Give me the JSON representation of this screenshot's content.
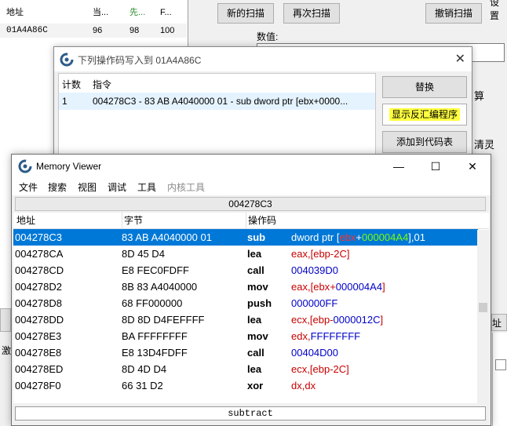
{
  "main_window": {
    "list_headers": {
      "address": "地址",
      "current": "当...",
      "previous": "先...",
      "first": "F..."
    },
    "list_row": {
      "address": "01A4A86C",
      "current": "96",
      "previous": "98",
      "first": "100"
    },
    "buttons": {
      "new_scan": "新的扫描",
      "next_scan": "再次扫描",
      "undo_scan": "撤销扫描"
    },
    "value_label": "数值:",
    "corner_text": "设置",
    "right_fragments": [
      "算",
      "清灵"
    ],
    "lower_fragments": {
      "left": "激",
      "right": "址"
    }
  },
  "dialog": {
    "title": "下列操作码写入到 01A4A86C",
    "headers": {
      "count": "计数",
      "instruction": "指令"
    },
    "row": {
      "count": "1",
      "instruction": "004278C3 - 83 AB A4040000 01 - sub dword ptr [ebx+0000..."
    },
    "buttons": {
      "replace": "替换",
      "show_disasm": "显示反汇编程序",
      "add_to_codelist": "添加到代码表"
    }
  },
  "memory_viewer": {
    "title": "Memory Viewer",
    "menu": [
      "文件",
      "搜索",
      "视图",
      "调试",
      "工具",
      "内核工具"
    ],
    "address_bar": "004278C3",
    "headers": {
      "address": "地址",
      "bytes": "字节",
      "opcode": "操作码"
    },
    "rows": [
      {
        "address": "004278C3",
        "bytes": "83 AB A4040000 01",
        "opcode": "sub",
        "operand": "dword ptr [ebx+000004A4],01"
      },
      {
        "address": "004278CA",
        "bytes": "8D 45 D4",
        "opcode": "lea",
        "operand": "eax,[ebp-2C]"
      },
      {
        "address": "004278CD",
        "bytes": "E8 FEC0FDFF",
        "opcode": "call",
        "operand": "004039D0"
      },
      {
        "address": "004278D2",
        "bytes": "8B 83 A4040000",
        "opcode": "mov",
        "operand": "eax,[ebx+000004A4]"
      },
      {
        "address": "004278D8",
        "bytes": "68 FF000000",
        "opcode": "push",
        "operand": "000000FF"
      },
      {
        "address": "004278DD",
        "bytes": "8D 8D D4FEFFFF",
        "opcode": "lea",
        "operand": "ecx,[ebp-0000012C]"
      },
      {
        "address": "004278E3",
        "bytes": "BA FFFFFFFF",
        "opcode": "mov",
        "operand": "edx,FFFFFFFF"
      },
      {
        "address": "004278E8",
        "bytes": "E8 13D4FDFF",
        "opcode": "call",
        "operand": "00404D00"
      },
      {
        "address": "004278ED",
        "bytes": "8D 4D D4",
        "opcode": "lea",
        "operand": "ecx,[ebp-2C]"
      },
      {
        "address": "004278F0",
        "bytes": "66 31 D2",
        "opcode": "xor",
        "operand": "dx,dx"
      }
    ],
    "status": "subtract",
    "colors": {
      "selection": "#0078d7",
      "register": "#c80000",
      "immediate": "#0000c8",
      "selected_register": "#ff3030",
      "selected_immediate": "#7dfc00"
    }
  }
}
